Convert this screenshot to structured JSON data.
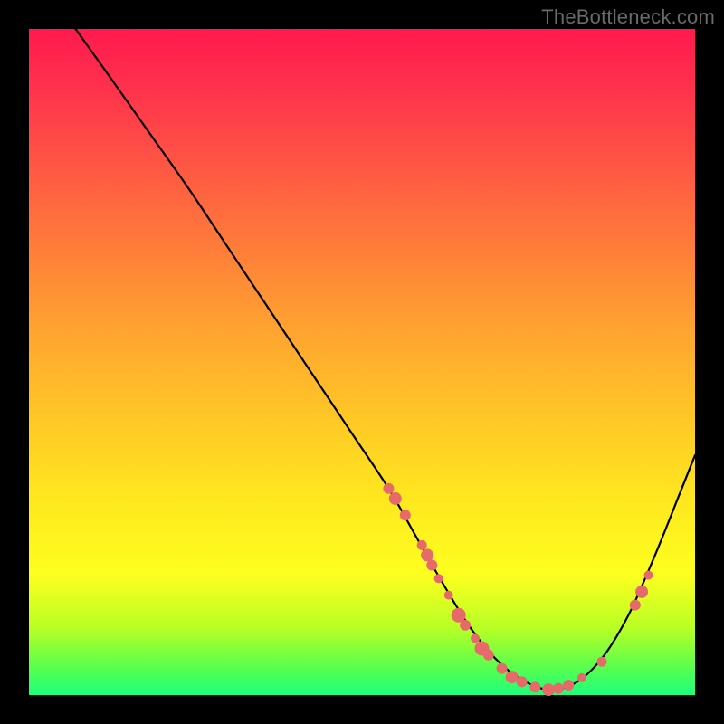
{
  "watermark": "TheBottleneck.com",
  "colors": {
    "dot": "#e76a6a",
    "curve": "#000000"
  },
  "chart_data": {
    "type": "line",
    "title": "",
    "xlabel": "",
    "ylabel": "",
    "xlim": [
      0,
      100
    ],
    "ylim": [
      0,
      100
    ],
    "series": [
      {
        "name": "curve",
        "x": [
          7,
          12,
          18,
          24,
          30,
          36,
          42,
          48,
          54,
          58,
          62,
          66,
          70,
          74,
          78,
          82,
          86,
          90,
          94,
          98,
          100
        ],
        "y": [
          100,
          93,
          84.5,
          76,
          67,
          58,
          49,
          40,
          31,
          24,
          17,
          10.5,
          5.5,
          2.3,
          0.8,
          1.8,
          5.5,
          12,
          21,
          31,
          36
        ]
      }
    ],
    "markers": [
      {
        "x": 54,
        "y": 31,
        "r": 6
      },
      {
        "x": 55,
        "y": 29.5,
        "r": 7
      },
      {
        "x": 56.5,
        "y": 27,
        "r": 6
      },
      {
        "x": 59,
        "y": 22.5,
        "r": 5.5
      },
      {
        "x": 59.8,
        "y": 21,
        "r": 7
      },
      {
        "x": 60.5,
        "y": 19.5,
        "r": 6
      },
      {
        "x": 61.5,
        "y": 17.5,
        "r": 5
      },
      {
        "x": 63,
        "y": 15,
        "r": 5
      },
      {
        "x": 64.5,
        "y": 12,
        "r": 8
      },
      {
        "x": 65.5,
        "y": 10.5,
        "r": 6
      },
      {
        "x": 67,
        "y": 8.5,
        "r": 5
      },
      {
        "x": 68,
        "y": 7,
        "r": 8
      },
      {
        "x": 69,
        "y": 6,
        "r": 6
      },
      {
        "x": 71,
        "y": 4,
        "r": 6
      },
      {
        "x": 72.5,
        "y": 2.7,
        "r": 7
      },
      {
        "x": 74,
        "y": 2,
        "r": 6
      },
      {
        "x": 76,
        "y": 1.2,
        "r": 6
      },
      {
        "x": 78,
        "y": 0.8,
        "r": 7
      },
      {
        "x": 79.5,
        "y": 1,
        "r": 6
      },
      {
        "x": 81,
        "y": 1.5,
        "r": 6
      },
      {
        "x": 83,
        "y": 2.6,
        "r": 5
      },
      {
        "x": 86,
        "y": 5,
        "r": 5.5
      },
      {
        "x": 91,
        "y": 13.5,
        "r": 6
      },
      {
        "x": 92,
        "y": 15.5,
        "r": 7
      },
      {
        "x": 93,
        "y": 18,
        "r": 5
      }
    ]
  }
}
